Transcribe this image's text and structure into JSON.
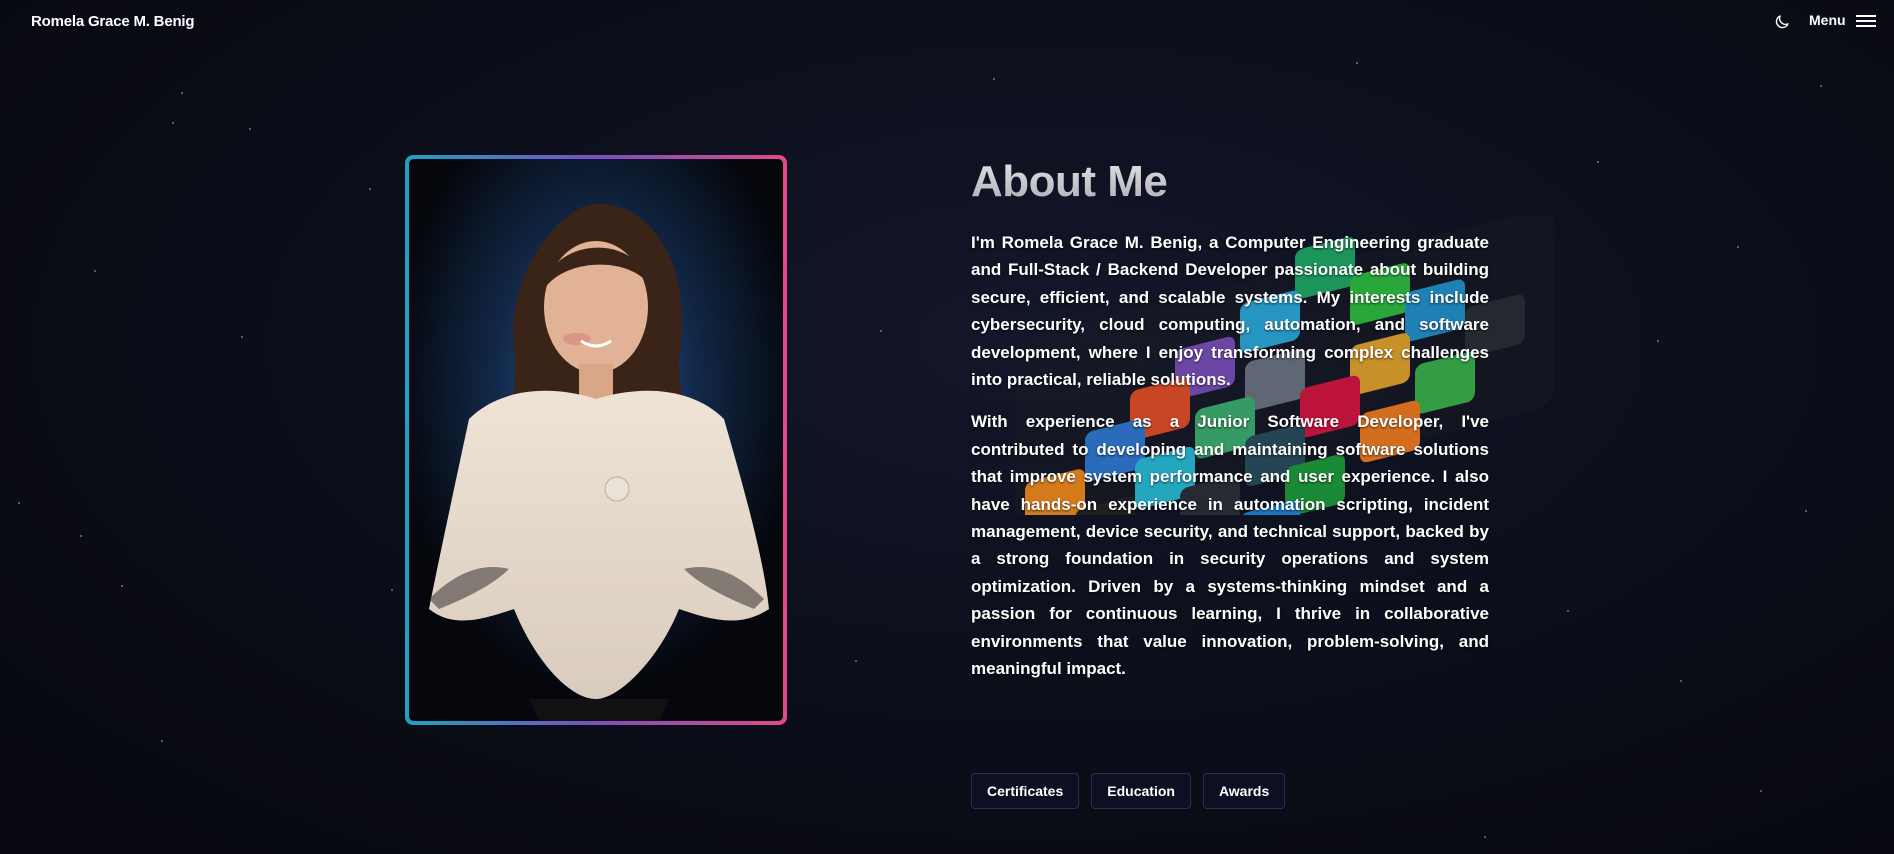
{
  "header": {
    "brand": "Romela Grace M. Benig",
    "theme_toggle_icon": "moon-icon",
    "menu_label": "Menu",
    "menu_icon": "hamburger-icon"
  },
  "about": {
    "title": "About Me",
    "paragraphs": [
      "I'm Romela Grace M. Benig, a Computer Engineering graduate and Full-Stack / Backend Developer passionate about building secure, efficient, and scalable systems. My interests include cybersecurity, cloud computing, automation, and software development, where I enjoy transforming complex challenges into practical, reliable solutions.",
      "With experience as a Junior Software Developer, I've contributed to developing and maintaining software solutions that improve system performance and user experience. I also have hands-on experience in automation scripting, incident management, device security, and technical support, backed by a strong foundation in security operations and system optimization. Driven by a systems-thinking mindset and a passion for continuous learning, I thrive in collaborative environments that value innovation, problem-solving, and meaningful impact."
    ]
  },
  "tabs": {
    "certificates": "Certificates",
    "education": "Education",
    "awards": "Awards"
  },
  "colors": {
    "frame_gradient_start": "#1fa1c4",
    "frame_gradient_mid": "#7b4fc0",
    "frame_gradient_end": "#e14a86",
    "background": "#0b0d18"
  }
}
